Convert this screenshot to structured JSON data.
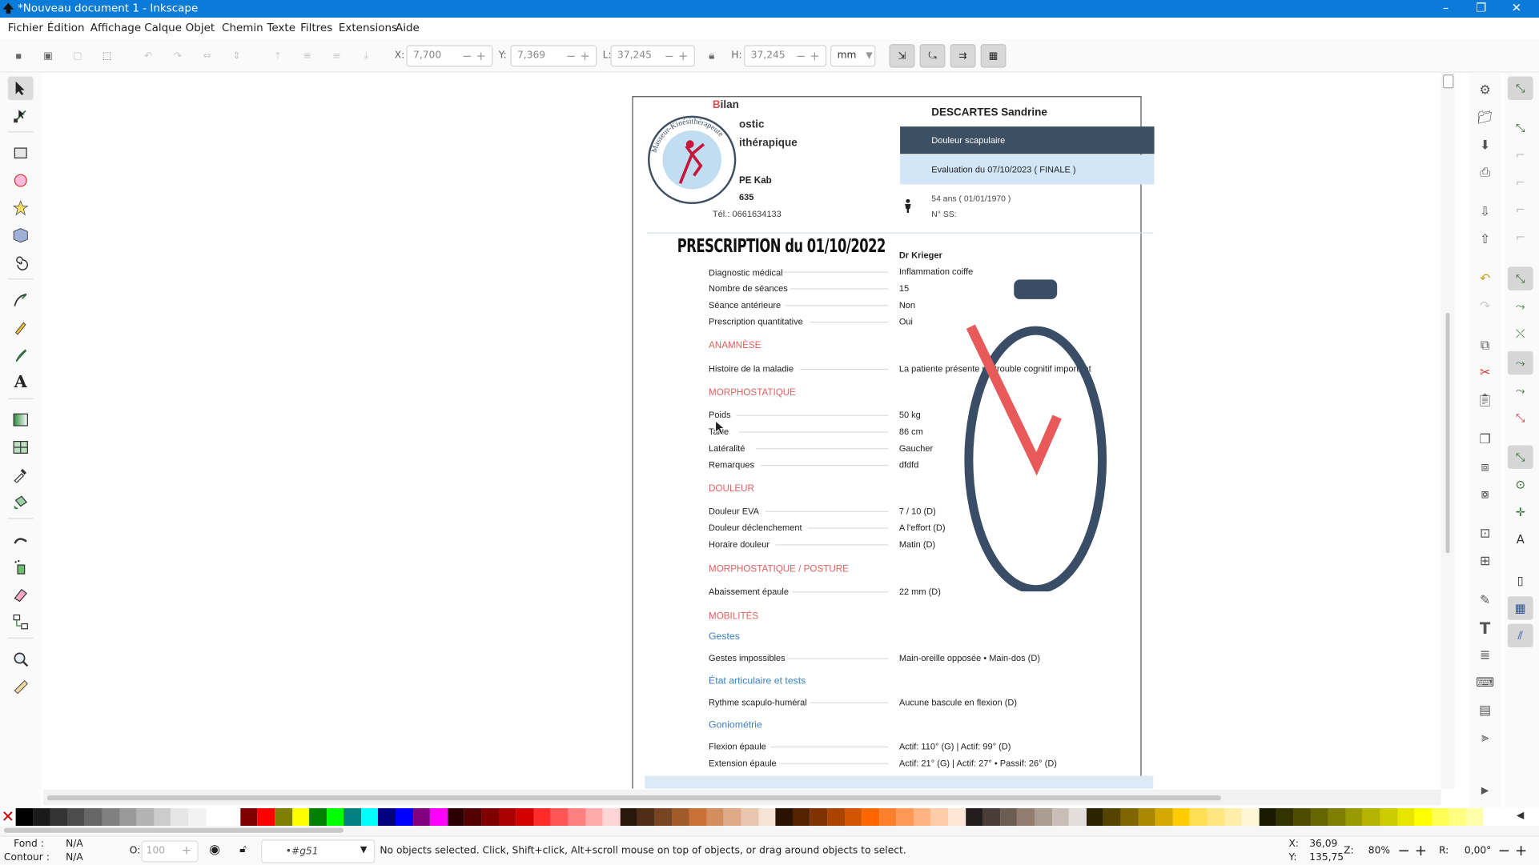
{
  "window": {
    "title": "*Nouveau document 1 - Inkscape",
    "controls": [
      "–",
      "❐",
      "✕"
    ]
  },
  "menu": [
    "Fichier",
    "Édition",
    "Affichage",
    "Calque",
    "Objet",
    "Chemin",
    "Texte",
    "Filtres",
    "Extensions",
    "Aide"
  ],
  "toolbar": {
    "x_label": "X:",
    "x_value": "7,700",
    "y_label": "Y:",
    "y_value": "7,369",
    "w_label": "L:",
    "w_value": "37,245",
    "h_label": "H:",
    "h_value": "37,245",
    "unit": "mm"
  },
  "document": {
    "logo_title_red": "B",
    "logo_title_rest": "ilan",
    "header_line2": "ostic",
    "header_line3": "ithérapique",
    "practice": "PE Kab",
    "code": "635",
    "phone": "Tél.: 0661634133",
    "logo_ring_text": "Masseur-Kinésithérapeute",
    "patient_name": "DESCARTES Sandrine",
    "complaint": "Douleur scapulaire",
    "evaluation": "Evaluation du 07/10/2023 ( FINALE )",
    "age": "54 ans ( 01/01/1970 )",
    "ss": "N° SS:",
    "prescription_title": "PRESCRIPTION du 01/10/2022",
    "prescriber": "Dr Krieger",
    "rows": [
      {
        "label": "Diagnostic médical",
        "value": "Inflammation coiffe"
      },
      {
        "label": "Nombre de séances",
        "value": "15"
      },
      {
        "label": "Séance antérieure",
        "value": "Non"
      },
      {
        "label": "Prescription quantitative",
        "value": "Oui"
      }
    ],
    "anamnese_title": "ANAMNÈSE",
    "anamnese_rows": [
      {
        "label": "Histoire de la maladie",
        "value": "La patiente présente un trouble cognitif important"
      }
    ],
    "morpho_title": "MORPHOSTATIQUE",
    "morpho_rows": [
      {
        "label": "Poids",
        "value": "50 kg"
      },
      {
        "label": "Taille",
        "value": "86 cm"
      },
      {
        "label": "Latéralité",
        "value": "Gaucher"
      },
      {
        "label": "Remarques",
        "value": "dfdfd"
      }
    ],
    "douleur_title": "DOULEUR",
    "douleur_rows": [
      {
        "label": "Douleur EVA",
        "value": "7 / 10 (D)"
      },
      {
        "label": "Douleur déclenchement",
        "value": "A l'effort (D)"
      },
      {
        "label": "Horaire douleur",
        "value": "Matin (D)"
      }
    ],
    "posture_title": "MORPHOSTATIQUE / POSTURE",
    "posture_rows": [
      {
        "label": "Abaissement épaule",
        "value": "22 mm (D)"
      }
    ],
    "mobilites_title": "MOBILITÉS",
    "gestes_title": "Gestes",
    "gestes_rows": [
      {
        "label": "Gestes impossibles",
        "value": "Main-oreille opposée • Main-dos (D)"
      }
    ],
    "etat_title": "État articulaire et tests",
    "etat_rows": [
      {
        "label": "Rythme scapulo-huméral",
        "value": "Aucune bascule en flexion (D)"
      }
    ],
    "gonio_title": "Goniométrie",
    "gonio_rows": [
      {
        "label": "Flexion épaule",
        "value": "Actif: 110° (G) | Actif: 99° (D)"
      },
      {
        "label": "Extension épaule",
        "value": "Actif: 21° (G) | Actif: 27° • Passif: 26° (D)"
      }
    ]
  },
  "status": {
    "fill_label": "Fond :",
    "fill_value": "N/A",
    "stroke_label": "Contour :",
    "stroke_value": "N/A",
    "opacity_label": "O:",
    "opacity_value": "100",
    "layer": "•#g51",
    "message": "No objects selected. Click, Shift+click, Alt+scroll mouse on top of objects, or drag around objects to select.",
    "x_label": "X:",
    "x_value": "36,09",
    "y_label": "Y:",
    "y_value": "135,75",
    "zoom_label": "Z:",
    "zoom_value": "80%",
    "rot_label": "R:",
    "rot_value": "0,00°"
  },
  "colors": {
    "accent": "#0a7bd8",
    "header_dark": "#3d4f63",
    "header_light": "#d3e6f7",
    "section_red": "#e06060",
    "section_blue": "#3a7fc4",
    "watch": "#3a4d66",
    "check": "#e85a5a"
  }
}
